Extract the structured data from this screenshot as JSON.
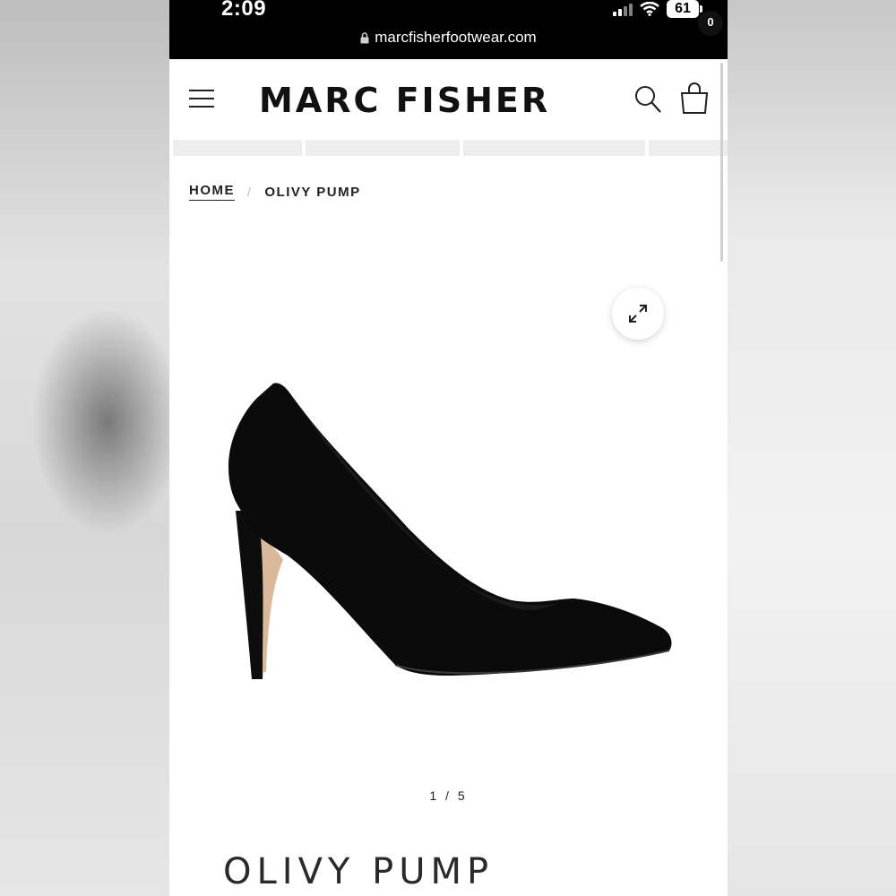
{
  "status_bar": {
    "time": "2:09",
    "battery": "61",
    "url": "marcfisherfootwear.com"
  },
  "header": {
    "logo": "MARC FISHER",
    "cart_count": "0"
  },
  "breadcrumb": {
    "home": "HOME",
    "separator": "/",
    "current": "OLIVY PUMP"
  },
  "gallery": {
    "counter": "1 / 5",
    "current_slide": 1,
    "total_slides": 5
  },
  "product": {
    "title": "OLIVY PUMP"
  },
  "icons": {
    "menu": "hamburger-icon",
    "search": "search-icon",
    "cart": "shopping-bag-icon",
    "expand": "expand-icon",
    "lock": "lock-icon"
  },
  "colors": {
    "brand_text": "#111111",
    "status_bar": "#000000",
    "background": "#ffffff"
  }
}
